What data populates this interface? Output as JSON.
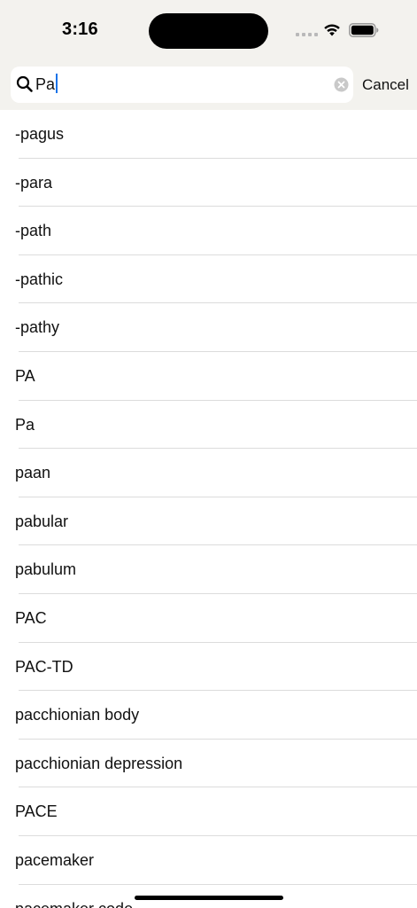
{
  "status_bar": {
    "time": "3:16"
  },
  "search": {
    "value": "Pa",
    "cancel_label": "Cancel"
  },
  "results": [
    "-pagus",
    "-para",
    "-path",
    "-pathic",
    "-pathy",
    "PA",
    "Pa",
    "paan",
    "pabular",
    "pabulum",
    "PAC",
    "PAC-TD",
    "pacchionian body",
    "pacchionian depression",
    "PACE",
    "pacemaker",
    "pacemaker code"
  ],
  "colors": {
    "header_background": "#f3f2ee",
    "caret": "#1a73e8",
    "separator": "#dcdcdc"
  },
  "icons": {
    "search": "search-icon",
    "clear": "clear-icon",
    "wifi": "wifi-icon",
    "battery": "battery-icon",
    "signal": "signal-icon"
  }
}
